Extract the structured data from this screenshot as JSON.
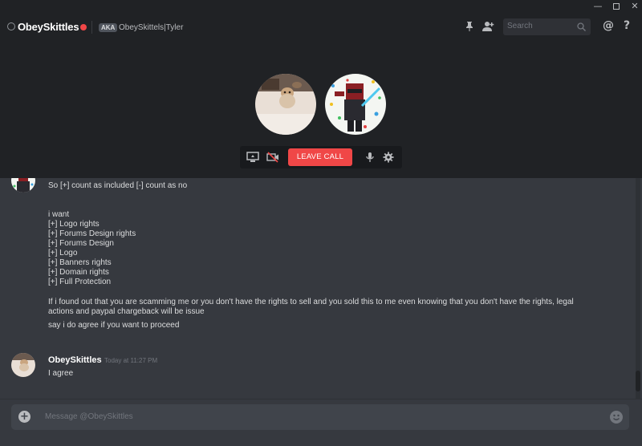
{
  "window": {
    "minimize": "—",
    "close": "✕"
  },
  "header": {
    "channel_name": "ObeySkittles",
    "aka_badge": "AKA",
    "aka_name": "ObeySkittels|Tyler",
    "search_placeholder": "Search",
    "mention_icon": "@",
    "help_icon": "?"
  },
  "call": {
    "leave_label": "LEAVE CALL"
  },
  "messages": {
    "intro_line": "So [+] count as included [-] count as no",
    "want_heading": "i want",
    "items": [
      "[+] Logo rights",
      "[+] Forums Design rights",
      "[+] Forums Design",
      "[+] Logo",
      "[+] Banners rights",
      "[+] Domain rights",
      "[+] Full Protection"
    ],
    "warning_line1": "If i found out that you are scamming me or you don't have the rights to sell and you sold this to me even knowing that you don't have the rights, legal",
    "warning_line2": "actions and paypal chargeback will be issue",
    "agree_prompt": "say i do agree if you want to proceed",
    "reply_author": "ObeySkittles",
    "reply_timestamp": "Today at 11:27 PM",
    "reply_text": "I agree"
  },
  "composer": {
    "placeholder": "Message @ObeySkittles",
    "upload": "+"
  },
  "colors": {
    "background": "#36393f",
    "header": "#202225",
    "danger": "#f04747",
    "text": "#dcddde"
  }
}
